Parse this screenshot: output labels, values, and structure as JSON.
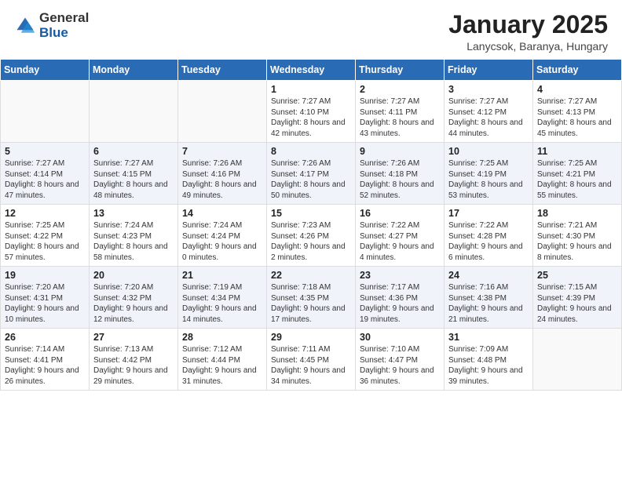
{
  "header": {
    "logo_general": "General",
    "logo_blue": "Blue",
    "title": "January 2025",
    "subtitle": "Lanycsok, Baranya, Hungary"
  },
  "weekdays": [
    "Sunday",
    "Monday",
    "Tuesday",
    "Wednesday",
    "Thursday",
    "Friday",
    "Saturday"
  ],
  "rows": [
    [
      {
        "day": "",
        "info": ""
      },
      {
        "day": "",
        "info": ""
      },
      {
        "day": "",
        "info": ""
      },
      {
        "day": "1",
        "info": "Sunrise: 7:27 AM\nSunset: 4:10 PM\nDaylight: 8 hours and 42 minutes."
      },
      {
        "day": "2",
        "info": "Sunrise: 7:27 AM\nSunset: 4:11 PM\nDaylight: 8 hours and 43 minutes."
      },
      {
        "day": "3",
        "info": "Sunrise: 7:27 AM\nSunset: 4:12 PM\nDaylight: 8 hours and 44 minutes."
      },
      {
        "day": "4",
        "info": "Sunrise: 7:27 AM\nSunset: 4:13 PM\nDaylight: 8 hours and 45 minutes."
      }
    ],
    [
      {
        "day": "5",
        "info": "Sunrise: 7:27 AM\nSunset: 4:14 PM\nDaylight: 8 hours and 47 minutes."
      },
      {
        "day": "6",
        "info": "Sunrise: 7:27 AM\nSunset: 4:15 PM\nDaylight: 8 hours and 48 minutes."
      },
      {
        "day": "7",
        "info": "Sunrise: 7:26 AM\nSunset: 4:16 PM\nDaylight: 8 hours and 49 minutes."
      },
      {
        "day": "8",
        "info": "Sunrise: 7:26 AM\nSunset: 4:17 PM\nDaylight: 8 hours and 50 minutes."
      },
      {
        "day": "9",
        "info": "Sunrise: 7:26 AM\nSunset: 4:18 PM\nDaylight: 8 hours and 52 minutes."
      },
      {
        "day": "10",
        "info": "Sunrise: 7:25 AM\nSunset: 4:19 PM\nDaylight: 8 hours and 53 minutes."
      },
      {
        "day": "11",
        "info": "Sunrise: 7:25 AM\nSunset: 4:21 PM\nDaylight: 8 hours and 55 minutes."
      }
    ],
    [
      {
        "day": "12",
        "info": "Sunrise: 7:25 AM\nSunset: 4:22 PM\nDaylight: 8 hours and 57 minutes."
      },
      {
        "day": "13",
        "info": "Sunrise: 7:24 AM\nSunset: 4:23 PM\nDaylight: 8 hours and 58 minutes."
      },
      {
        "day": "14",
        "info": "Sunrise: 7:24 AM\nSunset: 4:24 PM\nDaylight: 9 hours and 0 minutes."
      },
      {
        "day": "15",
        "info": "Sunrise: 7:23 AM\nSunset: 4:26 PM\nDaylight: 9 hours and 2 minutes."
      },
      {
        "day": "16",
        "info": "Sunrise: 7:22 AM\nSunset: 4:27 PM\nDaylight: 9 hours and 4 minutes."
      },
      {
        "day": "17",
        "info": "Sunrise: 7:22 AM\nSunset: 4:28 PM\nDaylight: 9 hours and 6 minutes."
      },
      {
        "day": "18",
        "info": "Sunrise: 7:21 AM\nSunset: 4:30 PM\nDaylight: 9 hours and 8 minutes."
      }
    ],
    [
      {
        "day": "19",
        "info": "Sunrise: 7:20 AM\nSunset: 4:31 PM\nDaylight: 9 hours and 10 minutes."
      },
      {
        "day": "20",
        "info": "Sunrise: 7:20 AM\nSunset: 4:32 PM\nDaylight: 9 hours and 12 minutes."
      },
      {
        "day": "21",
        "info": "Sunrise: 7:19 AM\nSunset: 4:34 PM\nDaylight: 9 hours and 14 minutes."
      },
      {
        "day": "22",
        "info": "Sunrise: 7:18 AM\nSunset: 4:35 PM\nDaylight: 9 hours and 17 minutes."
      },
      {
        "day": "23",
        "info": "Sunrise: 7:17 AM\nSunset: 4:36 PM\nDaylight: 9 hours and 19 minutes."
      },
      {
        "day": "24",
        "info": "Sunrise: 7:16 AM\nSunset: 4:38 PM\nDaylight: 9 hours and 21 minutes."
      },
      {
        "day": "25",
        "info": "Sunrise: 7:15 AM\nSunset: 4:39 PM\nDaylight: 9 hours and 24 minutes."
      }
    ],
    [
      {
        "day": "26",
        "info": "Sunrise: 7:14 AM\nSunset: 4:41 PM\nDaylight: 9 hours and 26 minutes."
      },
      {
        "day": "27",
        "info": "Sunrise: 7:13 AM\nSunset: 4:42 PM\nDaylight: 9 hours and 29 minutes."
      },
      {
        "day": "28",
        "info": "Sunrise: 7:12 AM\nSunset: 4:44 PM\nDaylight: 9 hours and 31 minutes."
      },
      {
        "day": "29",
        "info": "Sunrise: 7:11 AM\nSunset: 4:45 PM\nDaylight: 9 hours and 34 minutes."
      },
      {
        "day": "30",
        "info": "Sunrise: 7:10 AM\nSunset: 4:47 PM\nDaylight: 9 hours and 36 minutes."
      },
      {
        "day": "31",
        "info": "Sunrise: 7:09 AM\nSunset: 4:48 PM\nDaylight: 9 hours and 39 minutes."
      },
      {
        "day": "",
        "info": ""
      }
    ]
  ]
}
